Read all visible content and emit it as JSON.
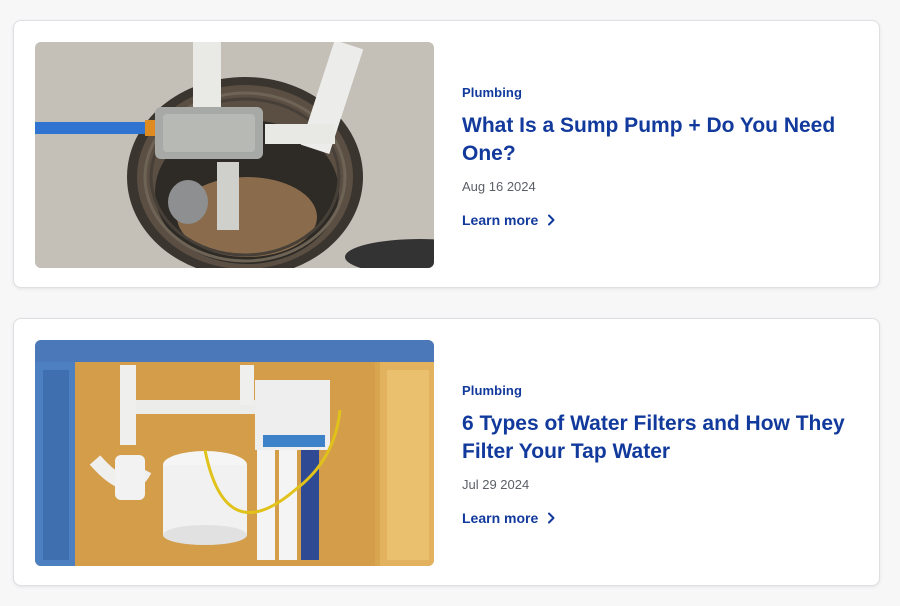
{
  "articles": [
    {
      "category": "Plumbing",
      "title": "What Is a Sump Pump + Do You Need One?",
      "date": "Aug 16 2024",
      "cta": "Learn more",
      "image_icon": "sump-pump-photo"
    },
    {
      "category": "Plumbing",
      "title": "6 Types of Water Filters and How They Filter Your Tap Water",
      "date": "Jul 29 2024",
      "cta": "Learn more",
      "image_icon": "water-filter-photo"
    }
  ],
  "colors": {
    "accent": "#123a9c",
    "date_text": "#5b5f67",
    "card_border": "#dedfe3",
    "page_bg": "#f7f7f8"
  }
}
